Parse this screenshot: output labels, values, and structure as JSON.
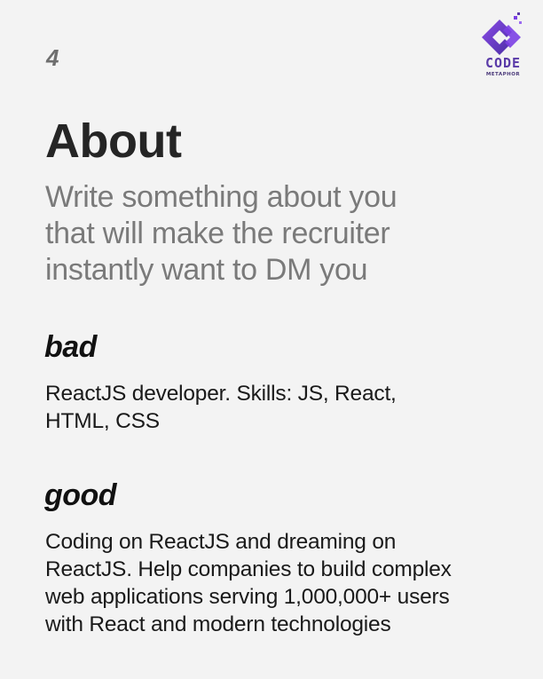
{
  "page_number": "4",
  "logo": {
    "name": "CODE",
    "tagline": "METAPHOR",
    "icon": "code-metaphor-logo-icon",
    "colors": [
      "#7b3fe4",
      "#4b2fa3"
    ]
  },
  "title": "About",
  "subtitle_lines": [
    "Write something about you",
    "that will make the recruiter",
    "instantly want to DM you"
  ],
  "bad": {
    "label": "bad",
    "text_lines": [
      "ReactJS developer. Skills: JS, React,",
      "HTML, CSS"
    ]
  },
  "good": {
    "label": "good",
    "text_lines": [
      "Coding on ReactJS and dreaming on",
      "ReactJS. Help companies to build complex",
      "web applications serving 1,000,000+ users",
      "with React and modern technologies"
    ]
  },
  "colors": {
    "background": "#f3f3f3",
    "subtitle": "#7a7a7a",
    "logo_purple": "#7b3fe4"
  }
}
